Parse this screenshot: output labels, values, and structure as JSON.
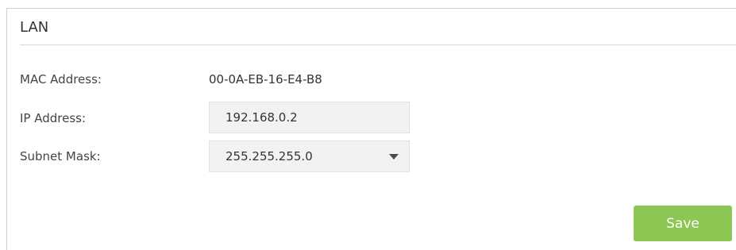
{
  "section": {
    "title": "LAN"
  },
  "form": {
    "mac": {
      "label": "MAC Address:",
      "value": "00-0A-EB-16-E4-B8"
    },
    "ip": {
      "label": "IP Address:",
      "value": "192.168.0.2"
    },
    "subnet": {
      "label": "Subnet Mask:",
      "selected": "255.255.255.0"
    }
  },
  "actions": {
    "save_label": "Save"
  },
  "colors": {
    "save_button": "#8cc653",
    "field_background": "#f2f2f2"
  },
  "icons": {
    "subnet_dropdown": "caret-down-icon"
  }
}
